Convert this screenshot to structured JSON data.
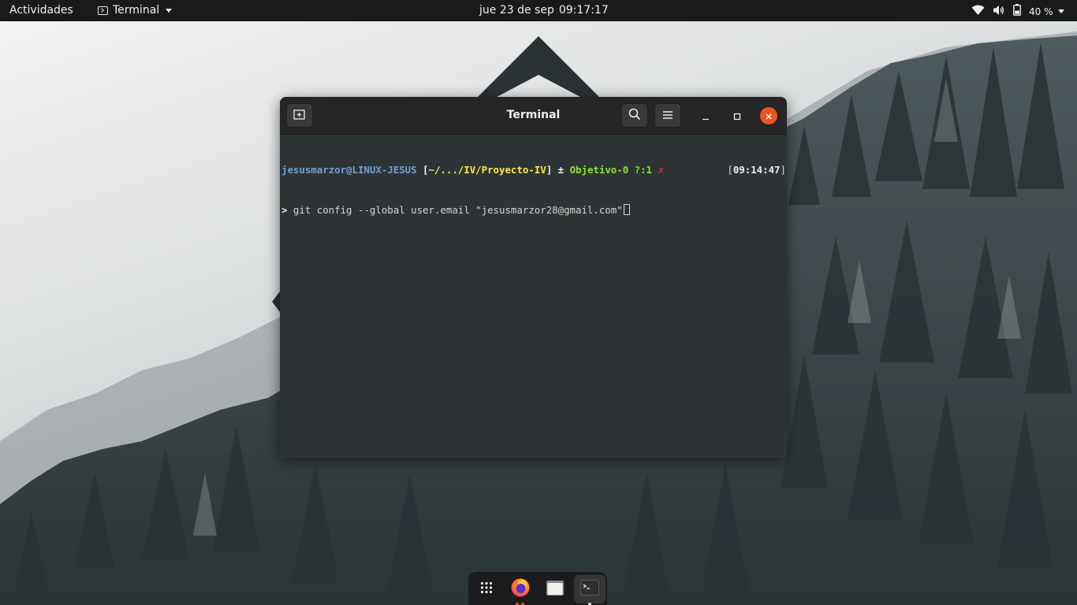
{
  "topbar": {
    "activities_label": "Actividades",
    "app_menu_label": "Terminal",
    "date": "jue 23 de sep",
    "time": "09:17:17",
    "battery_percent": "40 %"
  },
  "icons": {
    "wifi": "wifi-icon",
    "volume": "volume-icon",
    "battery": "battery-icon",
    "new_tab": "new-tab-icon",
    "search": "search-icon",
    "menu": "hamburger-menu-icon",
    "minimize": "minimize-icon",
    "maximize": "maximize-icon",
    "close": "close-icon"
  },
  "window": {
    "title": "Terminal"
  },
  "terminal": {
    "prompt": {
      "user_host": "jesusmarzor@LINUX-JESUS",
      "bracket_open": " [",
      "path": "~/.../IV/Proyecto-IV",
      "bracket_close": "]",
      "plusminus": " ± ",
      "branch": "Objetivo-0",
      "status": " ?:1 ",
      "dirty_mark": "✗",
      "time_open": "[",
      "time": "09:14:47",
      "time_close": "]"
    },
    "input": {
      "marker": "> ",
      "command": "git config --global user.email \"jesusmarzor28@gmail.com\""
    }
  },
  "dock": {
    "items": [
      "show-applications",
      "firefox",
      "files",
      "terminal"
    ]
  },
  "colors": {
    "accent": "#e95420",
    "topbar_bg": "#1a1a1a",
    "terminal_bg": "#2e3436",
    "prompt_user": "#729fcf",
    "prompt_path": "#fce94f",
    "prompt_branch": "#8ae234",
    "prompt_dirty": "#ef2929"
  }
}
